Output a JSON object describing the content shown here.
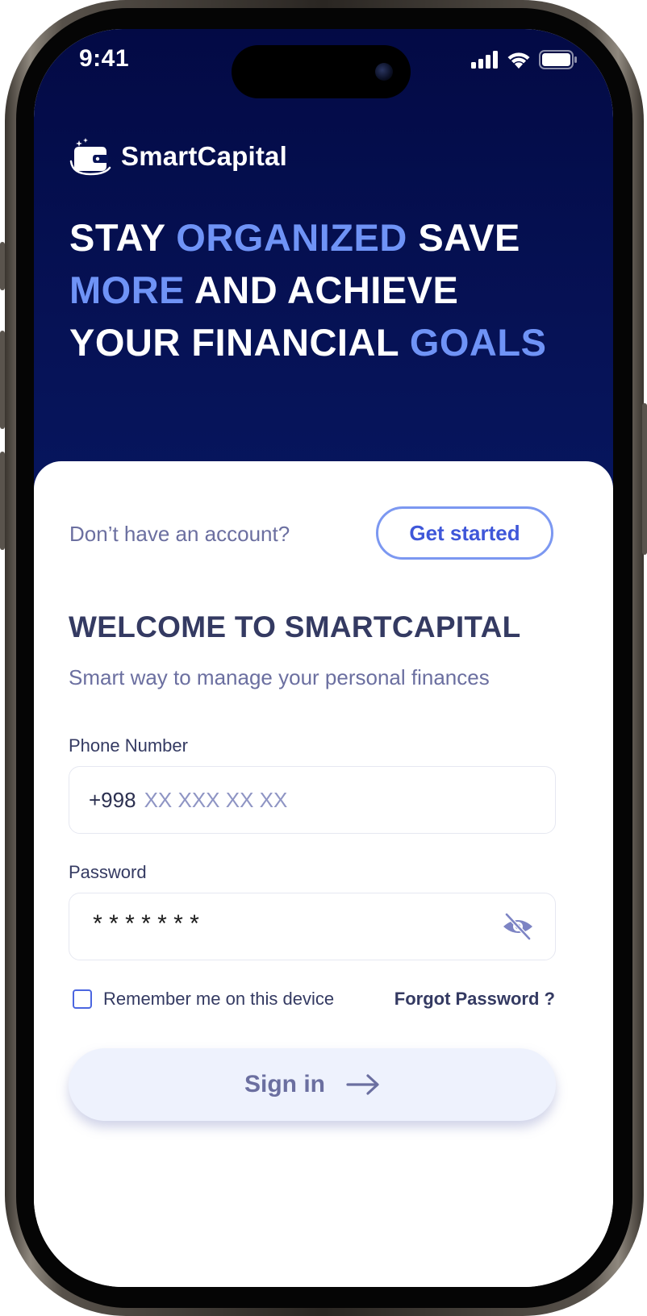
{
  "status_bar": {
    "time": "9:41"
  },
  "brand": {
    "name": "SmartCapital",
    "logo_icon": "wallet-logo-icon"
  },
  "headline": {
    "line1_a": "STAY ",
    "line1_accent": "ORGANIZED",
    "line1_b": " SAVE",
    "line2_accent": "MORE",
    "line2_b": " AND ACHIEVE",
    "line3_a": "YOUR FINANCIAL ",
    "line3_accent": "GOALS"
  },
  "signup_prompt": {
    "text": "Don’t have an account?",
    "button_label": "Get started"
  },
  "welcome": {
    "title": "WELCOME TO SMARTCAPITAL",
    "subtitle": "Smart way to manage your personal finances"
  },
  "form": {
    "phone": {
      "label": "Phone Number",
      "prefix": "+998",
      "placeholder": "XX XXX XX XX",
      "value": ""
    },
    "password": {
      "label": "Password",
      "value": "*******",
      "toggle_icon": "eye-slash-icon"
    },
    "remember": {
      "label": "Remember me on this device",
      "checked": false
    },
    "forgot_label": "Forgot Password ?",
    "submit_label": "Sign in"
  },
  "colors": {
    "hero_bg": "#061256",
    "accent": "#6f93f6",
    "primary_text": "#343a62",
    "muted_text": "#6b6fa0",
    "button_border": "#7c98f1",
    "button_text": "#3f57d9",
    "signin_bg": "#eef2fd"
  }
}
